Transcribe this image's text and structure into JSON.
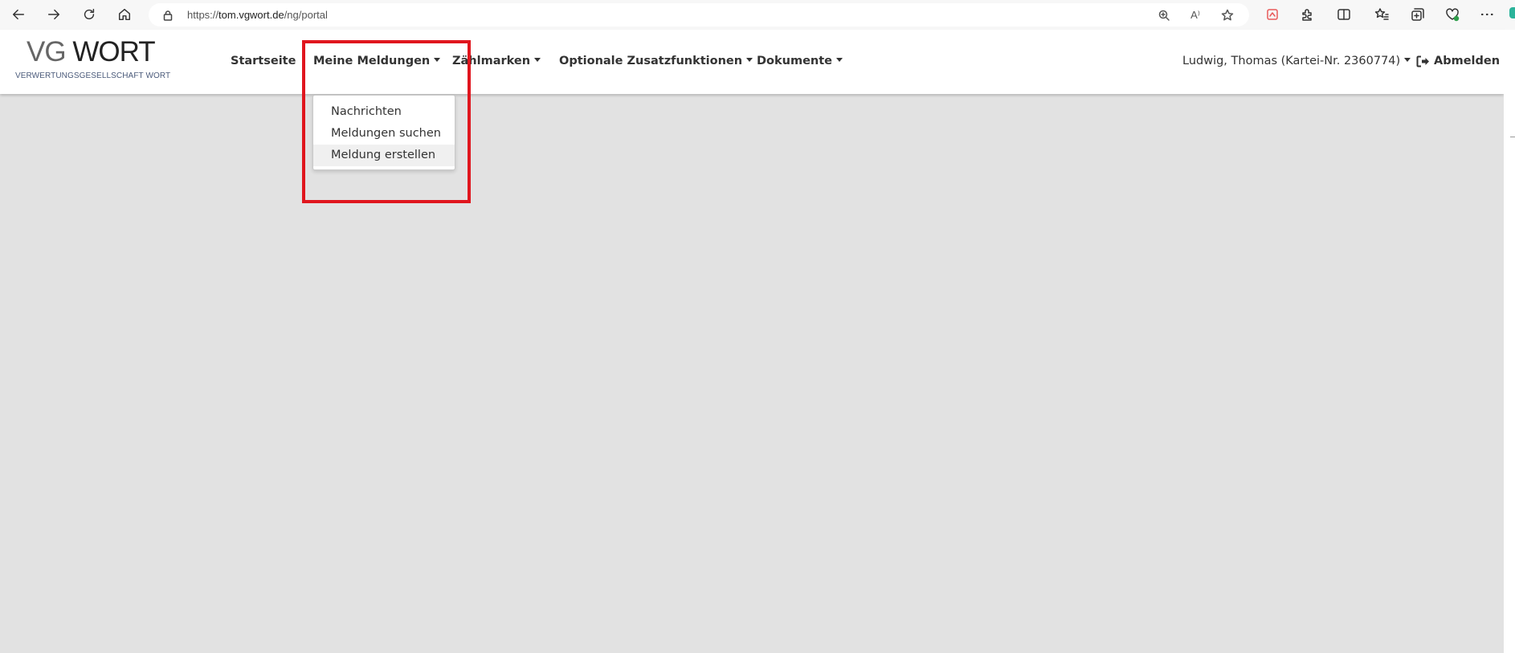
{
  "browser": {
    "url_prefix": "https://",
    "url_host": "tom.vgwort.de",
    "url_path": "/ng/portal",
    "read_aloud_label": "A⁾"
  },
  "logo": {
    "vg": "VG",
    "wort": "WORT",
    "subtitle": "VERWERTUNGSGESELLSCHAFT WORT"
  },
  "nav": {
    "startseite": "Startseite",
    "meine_meldungen": "Meine Meldungen",
    "zaehlmarken": "Zählmarken",
    "optionale": "Optionale Zusatzfunktionen",
    "dokumente": "Dokumente"
  },
  "user": {
    "name": "Ludwig, Thomas (Kartei-Nr. 2360774)",
    "logout": "Abmelden"
  },
  "dropdown": {
    "items": [
      "Nachrichten",
      "Meldungen suchen",
      "Meldung erstellen"
    ],
    "active_index": 2
  },
  "colors": {
    "highlight": "#e0161e",
    "page_background": "#e2e2e2"
  }
}
